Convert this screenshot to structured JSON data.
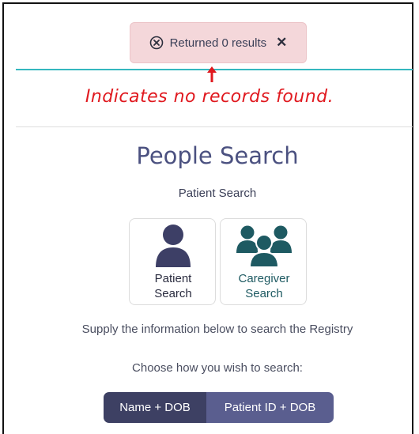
{
  "toast": {
    "message": "Returned 0 results",
    "close_symbol": "✕",
    "icon": "x-circle-icon"
  },
  "annotation": {
    "text": "Indicates no records found.",
    "color": "#e0191f"
  },
  "page": {
    "title": "People Search",
    "subtitle": "Patient Search"
  },
  "cards": [
    {
      "line1": "Patient",
      "line2": "Search",
      "icon": "person-icon",
      "color": "#3d3f66"
    },
    {
      "line1": "Caregiver",
      "line2": "Search",
      "icon": "group-icon",
      "color": "#1e5a62"
    }
  ],
  "instructions": {
    "info": "Supply the information below to search the Registry",
    "choose": "Choose how you wish to search:"
  },
  "search_modes": [
    {
      "label": "Name + DOB",
      "selected": true
    },
    {
      "label": "Patient ID + DOB",
      "selected": false
    }
  ],
  "colors": {
    "accent_line": "#35b8bf",
    "toast_bg": "#f4d7da",
    "primary": "#3d4063"
  }
}
